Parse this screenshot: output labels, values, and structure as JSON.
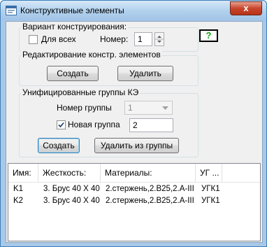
{
  "window": {
    "title": "Конструктивные элементы",
    "close_glyph": "x"
  },
  "variant_group": {
    "legend": "Вариант конструирования:",
    "for_all_label": "Для всех",
    "for_all_checked": false,
    "number_label": "Номер:",
    "number_value": "1",
    "help_label": "?"
  },
  "edit_group": {
    "legend": "Редактирование констр. элементов",
    "create_label": "Создать",
    "delete_label": "Удалить"
  },
  "unified_group": {
    "legend": "Унифицированные группы КЭ",
    "group_number_label": "Номер группы",
    "group_number_value": "1",
    "new_group_label": "Новая группа",
    "new_group_checked": true,
    "new_group_value": "2",
    "create_label": "Создать",
    "remove_label": "Удалить из группы"
  },
  "table": {
    "columns": [
      "Имя:",
      "Жесткость:",
      "Материалы:",
      "УГ ..."
    ],
    "rows": [
      [
        "K1",
        "3. Брус 40 X 40",
        "2.стержень,2.В25,2.А-III",
        "УГК1"
      ],
      [
        "K2",
        "3. Брус 40 X 40",
        "2.стержень,2.В25,2.А-III",
        "УГК1"
      ]
    ]
  }
}
